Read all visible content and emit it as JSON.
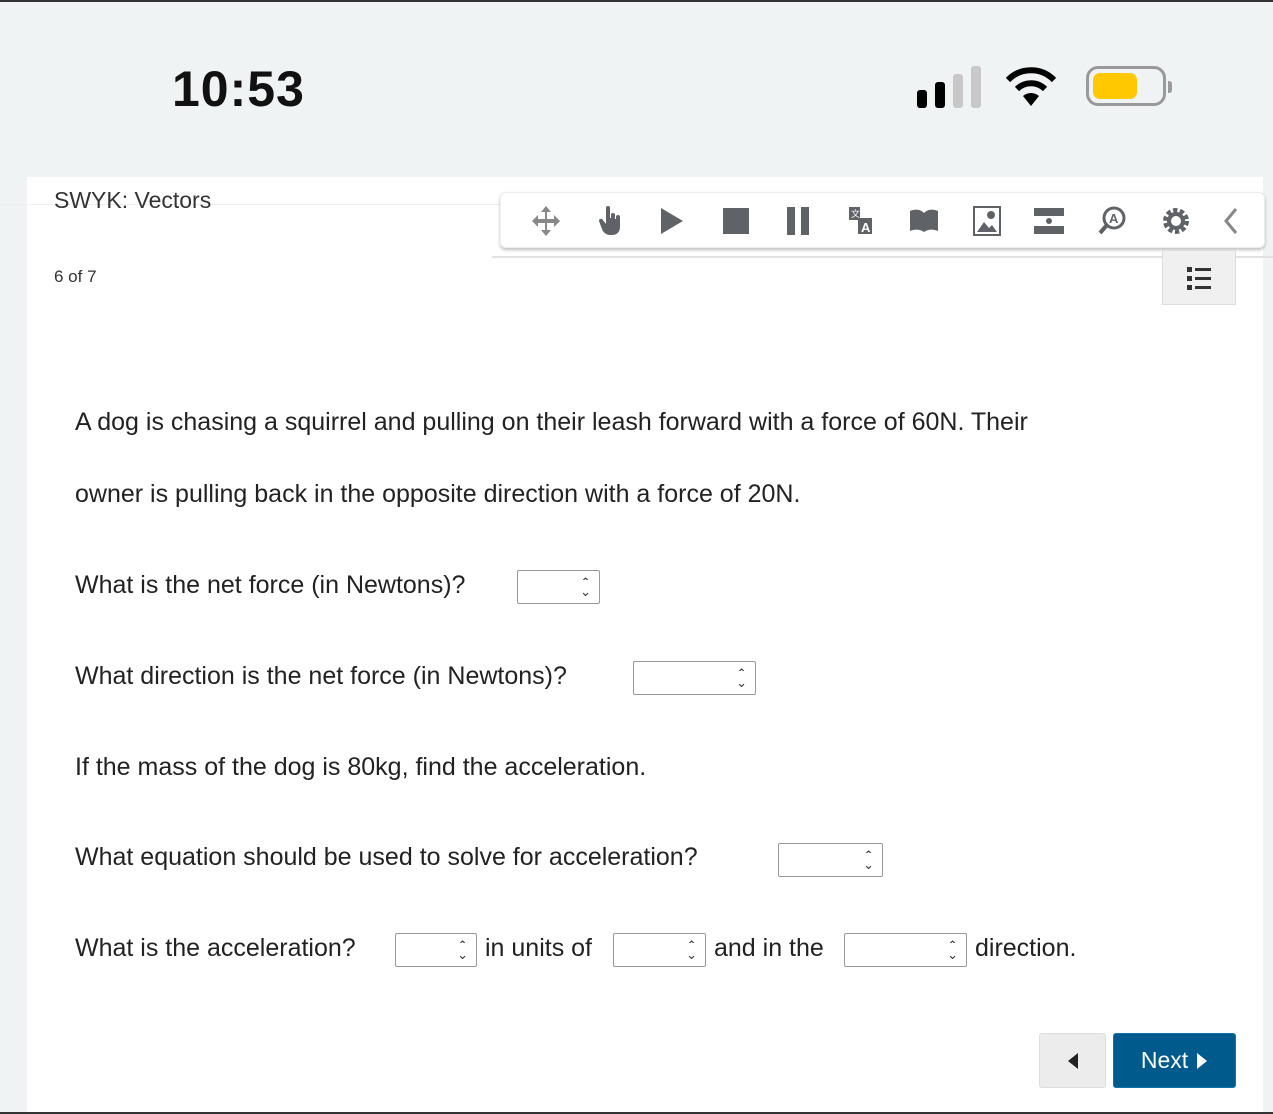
{
  "status_bar": {
    "time": "10:53",
    "signal_bars": 2,
    "battery_color": "#ffc800"
  },
  "header": {
    "title": "SWYK: Vectors",
    "progress": "6 of 7"
  },
  "toolbar": {
    "icons": [
      "move-icon",
      "pointer-hand-icon",
      "play-icon",
      "stop-icon",
      "pause-icon",
      "translate-icon",
      "dictionary-icon",
      "picture-dictionary-icon",
      "masking-icon",
      "text-magnifier-icon",
      "settings-icon",
      "collapse-chevron-icon"
    ]
  },
  "question": {
    "stem_line1": "A dog is chasing a squirrel and pulling on their leash forward with a force of 60N. Their",
    "stem_line2": "owner is pulling back in the opposite direction with a force of 20N.",
    "q1": "What is the net force (in Newtons)?",
    "q2": "What direction is the net force (in Newtons)?",
    "q3": "If the mass of the dog is 80kg, find the acceleration.",
    "q4": "What equation should be used to solve for acceleration?",
    "q5a": "What is the acceleration?",
    "q5b": "in units of",
    "q5c": "and in the",
    "q5d": "direction."
  },
  "nav": {
    "next_label": "Next",
    "accent": "#005a8c"
  }
}
